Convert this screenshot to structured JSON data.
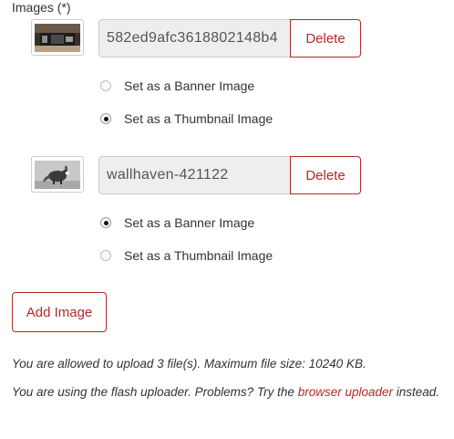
{
  "section": {
    "label": "Images (*)"
  },
  "images": [
    {
      "filename": "582ed9afc3618802148b4",
      "delete_label": "Delete",
      "thumbnail": "dark-image-thumbnail",
      "options": [
        {
          "label": "Set as a Banner Image",
          "checked": false
        },
        {
          "label": "Set as a Thumbnail Image",
          "checked": true
        }
      ]
    },
    {
      "filename": "wallhaven-421122",
      "delete_label": "Delete",
      "thumbnail": "fox-image-thumbnail",
      "options": [
        {
          "label": "Set as a Banner Image",
          "checked": true
        },
        {
          "label": "Set as a Thumbnail Image",
          "checked": false
        }
      ]
    }
  ],
  "add_image_label": "Add Image",
  "notes": {
    "upload_limit": "You are allowed to upload 3 file(s). Maximum file size: 10240 KB.",
    "flash_prefix": "You are using the flash uploader. Problems? Try the ",
    "flash_link": "browser uploader",
    "flash_suffix": " instead."
  },
  "colors": {
    "accent": "#b02a2a",
    "input_bg": "#eeeeee",
    "border": "#cccccc"
  }
}
